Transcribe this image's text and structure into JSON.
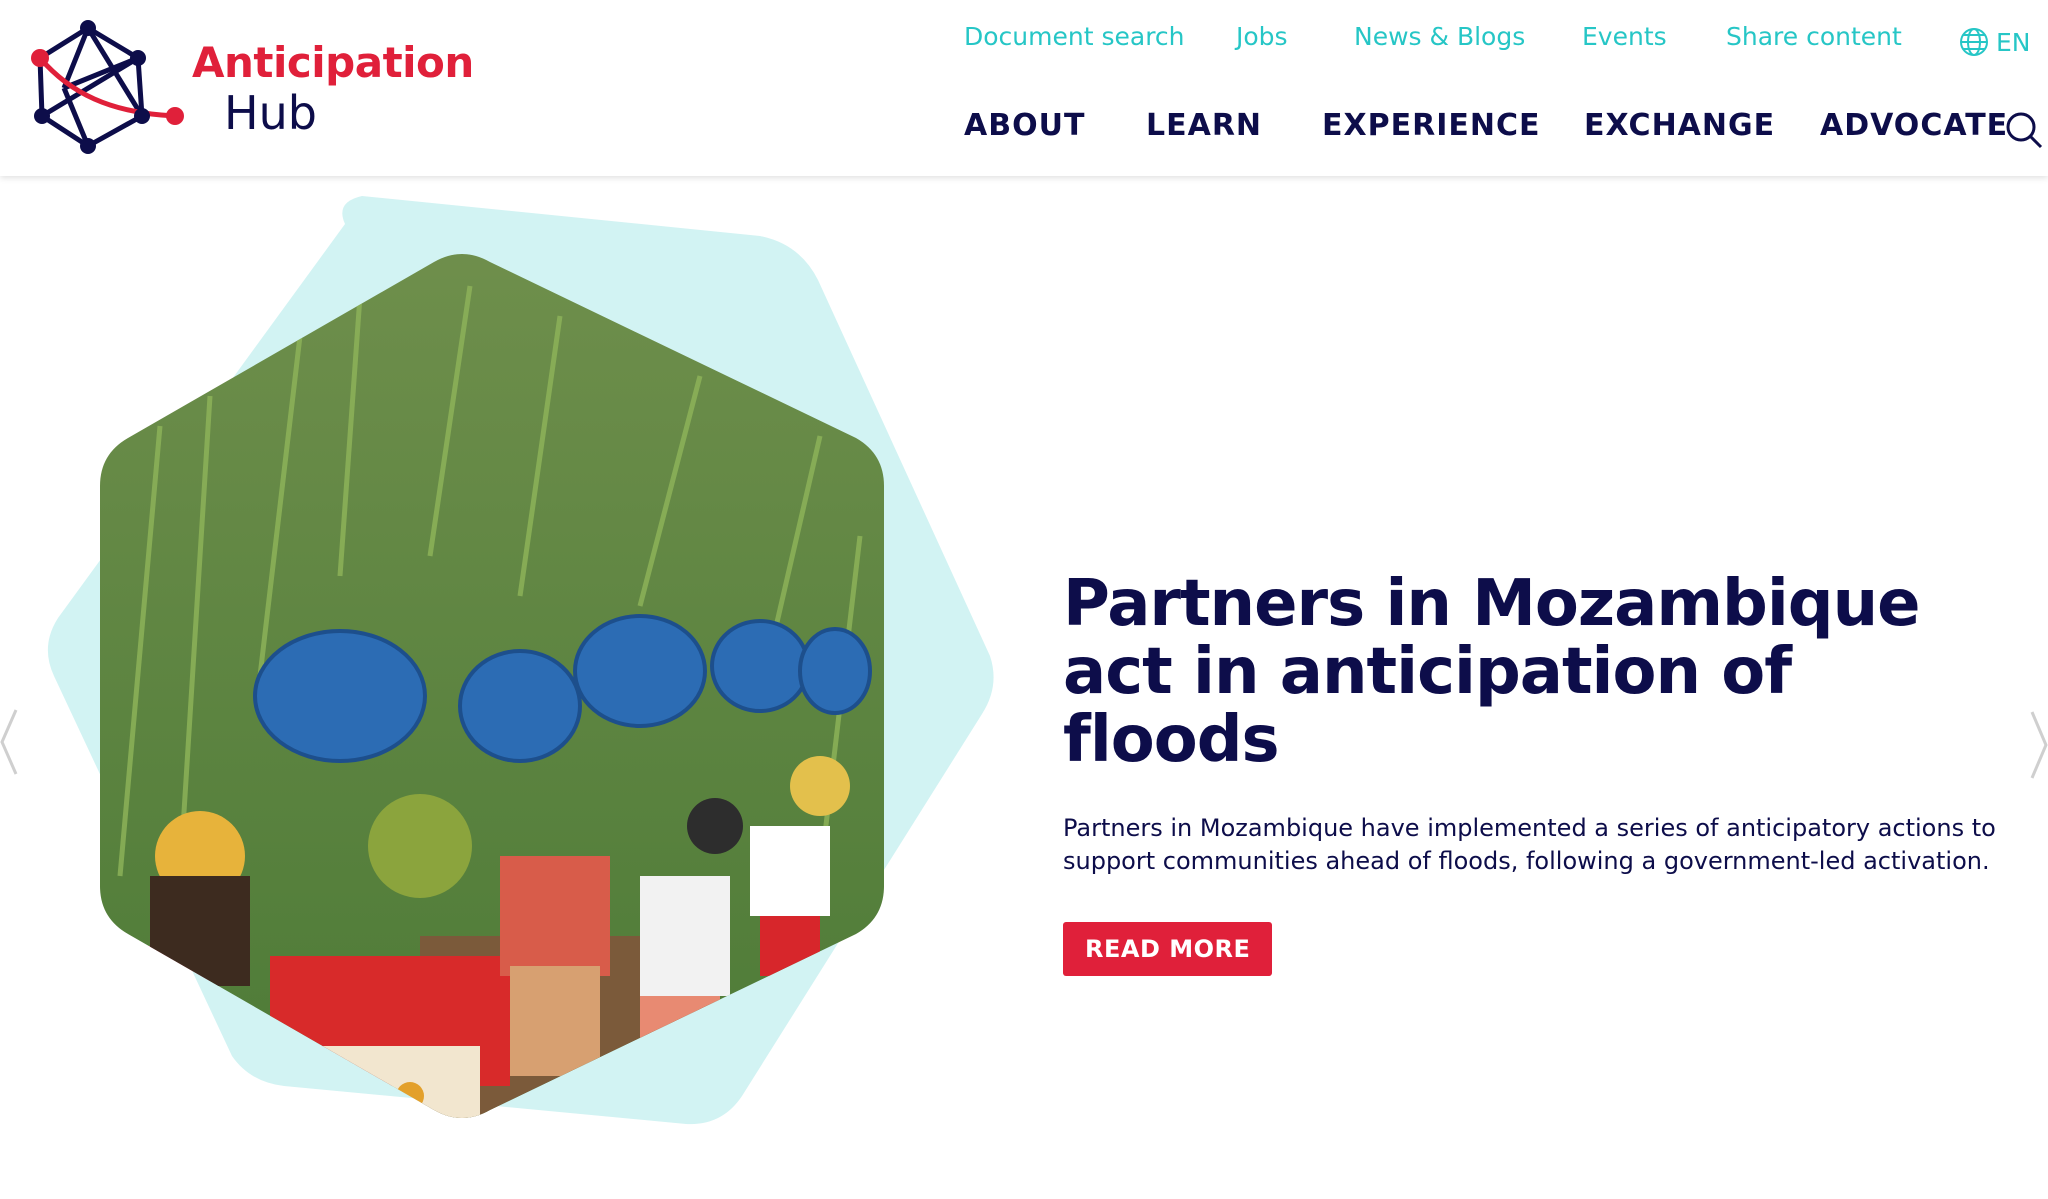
{
  "logo": {
    "line1": "Anticipation",
    "line2": "Hub",
    "icon": "network-globe-logo-icon"
  },
  "top_nav": {
    "links": [
      "Document search",
      "Jobs",
      "News & Blogs",
      "Events",
      "Share content"
    ],
    "language": "EN",
    "language_icon": "globe-icon"
  },
  "main_nav": {
    "items": [
      "ABOUT",
      "LEARN",
      "EXPERIENCE",
      "EXCHANGE",
      "ADVOCATE"
    ],
    "search_icon": "search-icon"
  },
  "hero": {
    "title": "Partners in Mozambique act in anticipation of floods",
    "description": "Partners in Mozambique have implemented a series of anticipatory actions to support communities ahead of floods, following a government-led activation.",
    "button_label": "READ MORE",
    "image_icon": "women-carrying-buckets-photo",
    "prev_icon": "chevron-left-icon",
    "next_icon": "chevron-right-icon"
  },
  "colors": {
    "accent_red": "#e0203a",
    "navy": "#0d0d4a",
    "teal": "#26c6c6",
    "hexagon_bg": "#d2f3f3"
  }
}
